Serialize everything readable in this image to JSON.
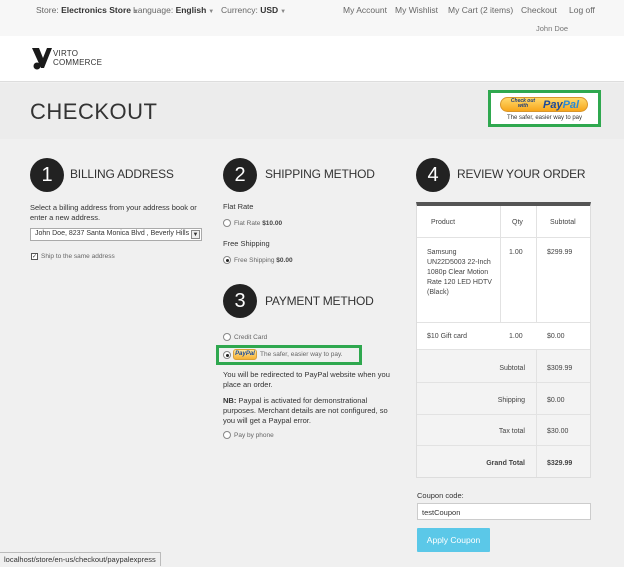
{
  "topbar": {
    "store_label": "Store:",
    "store_value": "Electronics Store",
    "language_label": "Language:",
    "language_value": "English",
    "currency_label": "Currency:",
    "currency_value": "USD",
    "my_account": "My Account",
    "my_wishlist": "My Wishlist",
    "my_cart": "My Cart (2 items)",
    "checkout": "Checkout",
    "logoff": "Log off",
    "user_name": "John Doe"
  },
  "logo": {
    "line1": "VIRTO",
    "line2": "COMMERCE"
  },
  "page_title": "CHECKOUT",
  "paypal_button": {
    "checkout_with": "Check out with",
    "brand_a": "Pay",
    "brand_b": "Pal",
    "tagline": "The safer, easier way to pay"
  },
  "billing": {
    "number": "1",
    "title": "BILLING ADDRESS",
    "instructions": "Select a billing address from your address book or enter a new address.",
    "address_selected": "John Doe, 8237 Santa Monica Blvd , Beverly Hills",
    "ship_same_label": "Ship to the same address"
  },
  "shipping": {
    "number": "2",
    "title": "SHIPPING METHOD",
    "group1_label": "Flat Rate",
    "option1_label": "Flat Rate",
    "option1_price": "$10.00",
    "group2_label": "Free Shipping",
    "option2_label": "Free Shipping",
    "option2_price": "$0.00"
  },
  "payment": {
    "number": "3",
    "title": "PAYMENT METHOD",
    "credit_card_label": "Credit Card",
    "paypal_logo": "PayPal",
    "paypal_tagline": "The safer, easier way to pay.",
    "redirect_note": "You will be redirected to PayPal website when you place an order.",
    "nb_label": "NB:",
    "nb_text": " Paypal is activated for demonstrational purposes. Merchant details are not configured, so you will get a Paypal error.",
    "pay_by_phone_label": "Pay by phone"
  },
  "review": {
    "number": "4",
    "title": "REVIEW YOUR ORDER",
    "columns": [
      "Product",
      "Qty",
      "Subtotal"
    ],
    "items": [
      {
        "product": "Samsung UN22D5003 22-Inch 1080p Clear Motion Rate 120 LED HDTV (Black)",
        "qty": "1.00",
        "subtotal": "$299.99"
      },
      {
        "product": "$10 Gift card",
        "qty": "1.00",
        "subtotal": "$0.00"
      }
    ],
    "totals": [
      {
        "label": "Subtotal",
        "value": "$309.99"
      },
      {
        "label": "Shipping",
        "value": "$0.00"
      },
      {
        "label": "Tax total",
        "value": "$30.00"
      },
      {
        "label": "Grand Total",
        "value": "$329.99"
      }
    ]
  },
  "coupon": {
    "label": "Coupon code:",
    "value": "testCoupon",
    "apply_label": "Apply Coupon"
  },
  "statusbar_url": "localhost/store/en-us/checkout/paypalexpress",
  "colors": {
    "highlight_green": "#2fa84f",
    "apply_button": "#5bc8e8",
    "step_circle": "#222222"
  }
}
